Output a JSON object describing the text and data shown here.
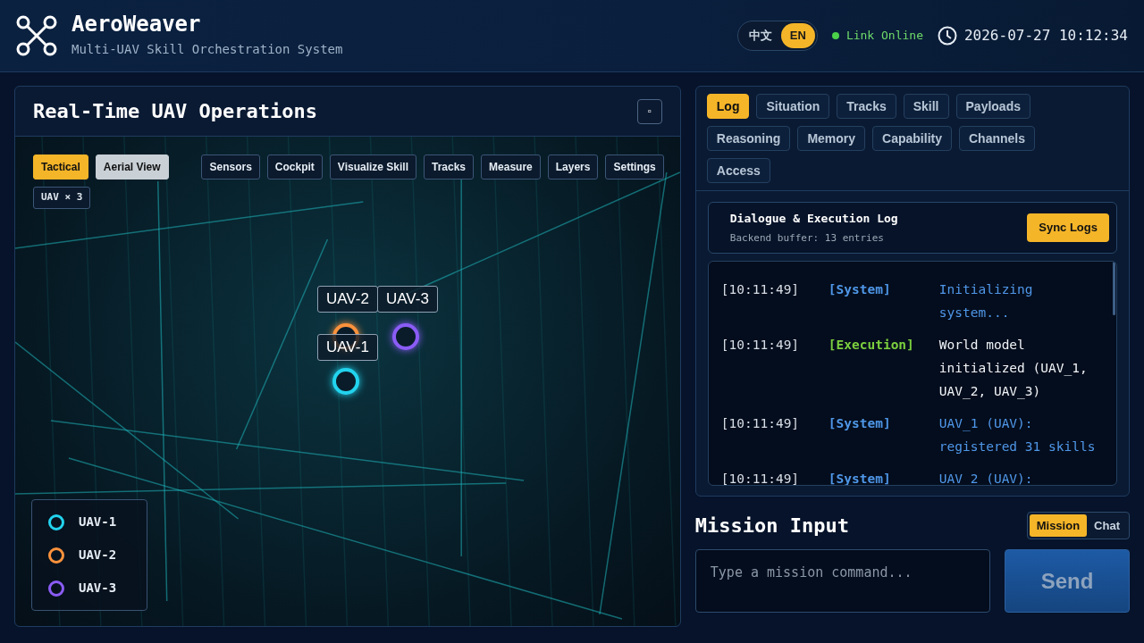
{
  "header": {
    "title": "AeroWeaver",
    "subtitle": "Multi-UAV Skill Orchestration System",
    "languages": [
      {
        "label": "中文",
        "selected": false
      },
      {
        "label": "EN",
        "selected": true
      }
    ],
    "link_status": {
      "label": "Link Online",
      "online": true
    },
    "datetime": "2026-07-27 10:12:34"
  },
  "operations": {
    "title": "Real-Time UAV Operations",
    "maximize": "▫",
    "view_modes": [
      {
        "label": "Tactical",
        "selected": true
      },
      {
        "label": "Aerial View",
        "selected": false
      }
    ],
    "tools": [
      "Sensors",
      "Cockpit",
      "Visualize Skill",
      "Tracks",
      "Measure",
      "Layers",
      "Settings"
    ],
    "uav_count": "UAV × 3",
    "uavs": [
      {
        "label": "UAV-1",
        "color": "#22d3ee"
      },
      {
        "label": "UAV-2",
        "color": "#fb923c"
      },
      {
        "label": "UAV-3",
        "color": "#8b5cf6"
      }
    ],
    "legend": [
      {
        "label": "UAV-1",
        "color": "#22d3ee"
      },
      {
        "label": "UAV-2",
        "color": "#fb923c"
      },
      {
        "label": "UAV-3",
        "color": "#8b5cf6"
      }
    ]
  },
  "side_tabs": [
    {
      "label": "Log",
      "selected": true
    },
    {
      "label": "Situation",
      "selected": false
    },
    {
      "label": "Tracks",
      "selected": false
    },
    {
      "label": "Skill",
      "selected": false
    },
    {
      "label": "Payloads",
      "selected": false
    },
    {
      "label": "Reasoning",
      "selected": false
    },
    {
      "label": "Memory",
      "selected": false
    },
    {
      "label": "Capability",
      "selected": false
    },
    {
      "label": "Channels",
      "selected": false
    },
    {
      "label": "Access",
      "selected": false
    }
  ],
  "log": {
    "title": "Dialogue & Execution Log",
    "subtitle": "Backend buffer: 13 entries",
    "sync_button": "Sync Logs",
    "entries": [
      {
        "time": "[10:11:49]",
        "kind": "system",
        "source": "[System]",
        "message": "Initializing system..."
      },
      {
        "time": "[10:11:49]",
        "kind": "execution",
        "source": "[Execution]",
        "message": "World model initialized (UAV_1, UAV_2, UAV_3)"
      },
      {
        "time": "[10:11:49]",
        "kind": "system",
        "source": "[System]",
        "message": "UAV_1 (UAV): registered 31 skills"
      },
      {
        "time": "[10:11:49]",
        "kind": "system",
        "source": "[System]",
        "message": "UAV_2 (UAV):"
      }
    ]
  },
  "mission": {
    "title": "Mission Input",
    "modes": [
      {
        "label": "Mission",
        "selected": true
      },
      {
        "label": "Chat",
        "selected": false
      }
    ],
    "placeholder": "Type a mission command...",
    "send": {
      "label": "Send",
      "disabled": true
    }
  }
}
